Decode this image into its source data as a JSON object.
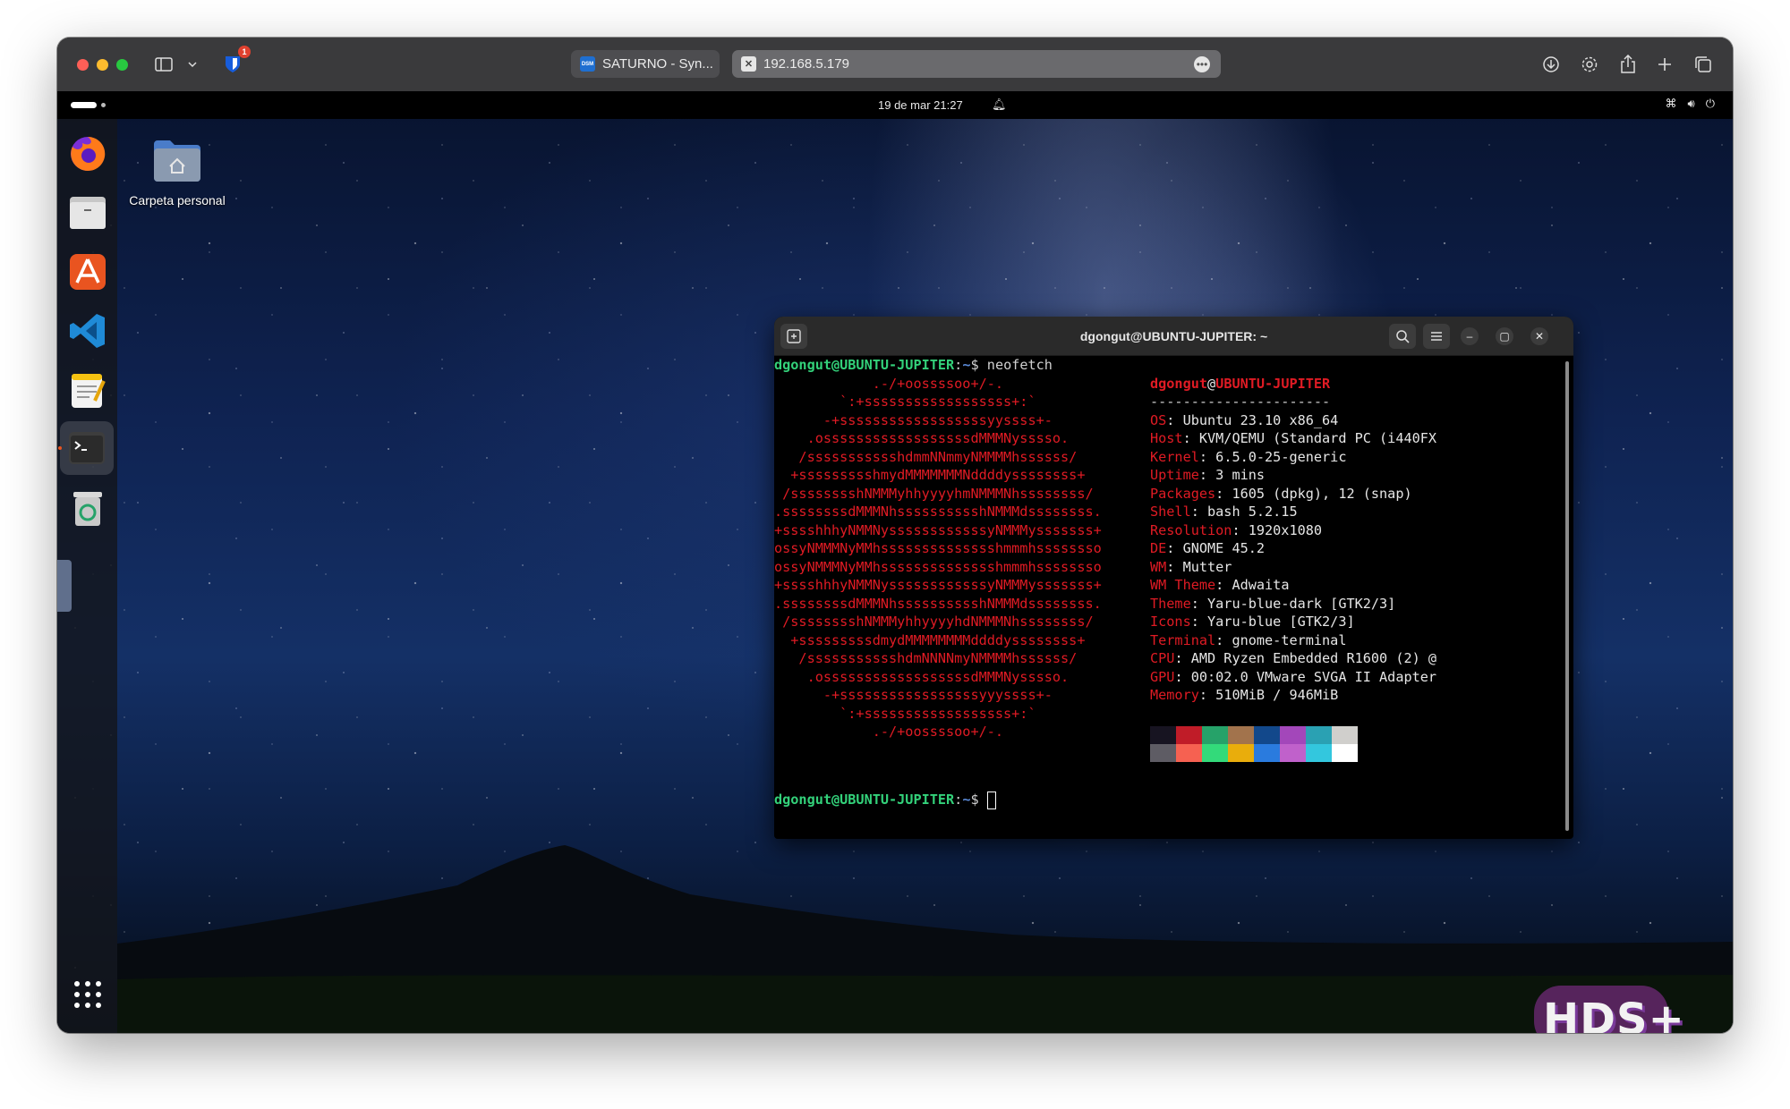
{
  "browser": {
    "tabs": [
      {
        "label": "SATURNO - Syn...",
        "favicon": "DSM"
      },
      {
        "label": "192.168.5.179"
      }
    ],
    "badge_count": "1"
  },
  "topbar": {
    "clock": "19 de mar  21:27"
  },
  "desktop": {
    "home_folder_label": "Carpeta personal",
    "dock_items": [
      "firefox-icon",
      "files-icon",
      "app-center-icon",
      "vscode-icon",
      "text-editor-icon",
      "terminal-icon",
      "trash-icon",
      "show-apps-icon"
    ]
  },
  "terminal": {
    "title": "dgongut@UBUNTU-JUPITER: ~",
    "prompt_user": "dgongut@UBUNTU-JUPITER",
    "prompt_sep": ":",
    "prompt_path": "~",
    "prompt_symbol": "$",
    "command": "neofetch",
    "info_user": "dgongut",
    "info_at": "@",
    "info_host": "UBUNTU-JUPITER",
    "separator": "----------------------",
    "info": [
      {
        "label": "OS",
        "value": "Ubuntu 23.10 x86_64"
      },
      {
        "label": "Host",
        "value": "KVM/QEMU (Standard PC (i440FX"
      },
      {
        "label": "Kernel",
        "value": "6.5.0-25-generic"
      },
      {
        "label": "Uptime",
        "value": "3 mins"
      },
      {
        "label": "Packages",
        "value": "1605 (dpkg), 12 (snap)"
      },
      {
        "label": "Shell",
        "value": "bash 5.2.15"
      },
      {
        "label": "Resolution",
        "value": "1920x1080"
      },
      {
        "label": "DE",
        "value": "GNOME 45.2"
      },
      {
        "label": "WM",
        "value": "Mutter"
      },
      {
        "label": "WM Theme",
        "value": "Adwaita"
      },
      {
        "label": "Theme",
        "value": "Yaru-blue-dark [GTK2/3]"
      },
      {
        "label": "Icons",
        "value": "Yaru-blue [GTK2/3]"
      },
      {
        "label": "Terminal",
        "value": "gnome-terminal"
      },
      {
        "label": "CPU",
        "value": "AMD Ryzen Embedded R1600 (2) @"
      },
      {
        "label": "GPU",
        "value": "00:02.0 VMware SVGA II Adapter"
      },
      {
        "label": "Memory",
        "value": "510MiB / 946MiB"
      }
    ],
    "ascii": [
      "            .-/+oossssoo+/-.",
      "        `:+ssssssssssssssssss+:`",
      "      -+ssssssssssssssssssyyssss+-",
      "    .ossssssssssssssssssdMMMNysssso.",
      "   /ssssssssssshdmmNNmmyNMMMMhssssss/",
      "  +ssssssssshmydMMMMMMMNddddyssssssss+",
      " /sssssssshNMMMyhhyyyyhmNMMMNhssssssss/",
      ".ssssssssdMMMNhsssssssssshNMMMdssssssss.",
      "+sssshhhyNMMNyssssssssssssyNMMMysssssss+",
      "ossyNMMMNyMMhsssssssssssssshmmmhssssssso",
      "ossyNMMMNyMMhsssssssssssssshmmmhssssssso",
      "+sssshhhyNMMNyssssssssssssyNMMMysssssss+",
      ".ssssssssdMMMNhsssssssssshNMMMdssssssss.",
      " /sssssssshNMMMyhhyyyyhdNMMMNhssssssss/",
      "  +sssssssssdmydMMMMMMMMddddyssssssss+",
      "   /ssssssssssshdmNNNNmyNMMMMhssssss/",
      "    .ossssssssssssssssssdMMMNysssso.",
      "      -+sssssssssssssssssyyyssss+-",
      "        `:+ssssssssssssssssss+:`",
      "            .-/+oossssoo+/-."
    ],
    "palette_top": [
      "#171421",
      "#c01c28",
      "#26a269",
      "#a2734c",
      "#12488b",
      "#a347ba",
      "#2aa1b3",
      "#d0cfcc"
    ],
    "palette_bottom": [
      "#5e5c64",
      "#f66151",
      "#33da7a",
      "#e9ad0c",
      "#2a7bde",
      "#c061cb",
      "#33c7de",
      "#ffffff"
    ]
  },
  "watermark": "HDS+"
}
